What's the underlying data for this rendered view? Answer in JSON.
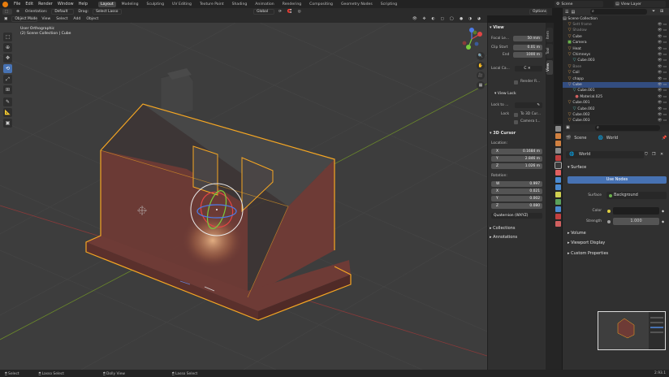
{
  "menubar": {
    "items": [
      "File",
      "Edit",
      "Render",
      "Window",
      "Help"
    ],
    "workspaces": [
      "Layout",
      "Modeling",
      "Sculpting",
      "UV Editing",
      "Texture Paint",
      "Shading",
      "Animation",
      "Rendering",
      "Compositing",
      "Geometry Nodes",
      "Scripting"
    ],
    "active_workspace": "Layout",
    "scene": "Scene",
    "view_layer": "View Layer"
  },
  "header": {
    "orientation_label": "Orientation:",
    "orientation_value": "Default",
    "drag_label": "Drag:",
    "drag_value": "Select Lasso",
    "transform_space": "Global",
    "options_label": "Options"
  },
  "viewport_header": {
    "mode": "Object Mode",
    "menus": [
      "View",
      "Select",
      "Add",
      "Object"
    ]
  },
  "viewport": {
    "view_name": "User Orthographic",
    "collection_info": "(2) Scene Collection | Cube"
  },
  "npanel": {
    "tabs": [
      "Item",
      "Tool",
      "View"
    ],
    "active_tab": "View",
    "view": {
      "title": "View",
      "focal_length_label": "Focal Le...",
      "focal_length": "50 mm",
      "clip_start_label": "Clip Start",
      "clip_start": "0.01 m",
      "clip_end_label": "End",
      "clip_end": "1000 m",
      "local_camera_label": "Local Ca...",
      "local_camera_c": "C",
      "render_region_label": "Render R..."
    },
    "view_lock": {
      "title": "View Lock",
      "lock_to_label": "Lock to ...",
      "lock_label": "Lock",
      "to_3d_cursor": "To 3D Cur...",
      "camera_to": "Camera t..."
    },
    "cursor": {
      "title": "3D Cursor",
      "location_label": "Location:",
      "x_label": "X",
      "x": "0.1684 m",
      "y_label": "Y",
      "y": "2.846 m",
      "z_label": "Z",
      "z": "1.026 m",
      "rotation_label": "Rotation:",
      "w_label": "W",
      "w": "0.997",
      "rx_label": "X",
      "rx": "0.021",
      "ry_label": "Y",
      "ry": "0.002",
      "rz_label": "Z",
      "rz": "0.080",
      "rotation_mode": "Quaternion (WXYZ)"
    },
    "collections_title": "Collections",
    "annotations_title": "Annotations"
  },
  "outliner": {
    "root": "Scene Collection",
    "rows": [
      {
        "indent": 2,
        "icon": "▽",
        "icolor": "#e0a050",
        "label": "Sett frame",
        "dim": true
      },
      {
        "indent": 2,
        "icon": "▽",
        "icolor": "#e0a050",
        "label": "Shadow",
        "dim": true
      },
      {
        "indent": 2,
        "icon": "▽",
        "icolor": "#e0a050",
        "label": "Cube"
      },
      {
        "indent": 2,
        "icon": "■",
        "icolor": "#6ab04c",
        "label": "Camera"
      },
      {
        "indent": 2,
        "icon": "▽",
        "icolor": "#e0a050",
        "label": "Heat"
      },
      {
        "indent": 2,
        "icon": "▽",
        "icolor": "#e0a050",
        "label": "Chimneys"
      },
      {
        "indent": 4,
        "icon": "▽",
        "icolor": "#5ec7c0",
        "label": "Cube.003"
      },
      {
        "indent": 2,
        "icon": "▽",
        "icolor": "#e0a050",
        "label": "Base",
        "dim": true
      },
      {
        "indent": 2,
        "icon": "▽",
        "icolor": "#e0a050",
        "label": "Coil"
      },
      {
        "indent": 2,
        "icon": "▽",
        "icolor": "#e0a050",
        "label": "chapp"
      },
      {
        "indent": 2,
        "icon": "▽",
        "icolor": "#e0a050",
        "label": "Cube",
        "sel": true
      },
      {
        "indent": 4,
        "icon": "▽",
        "icolor": "#5ec7c0",
        "label": "Cube.001"
      },
      {
        "indent": 5,
        "icon": "●",
        "icolor": "#d06060",
        "label": "Material.025"
      },
      {
        "indent": 2,
        "icon": "▽",
        "icolor": "#e0a050",
        "label": "Cube.001"
      },
      {
        "indent": 4,
        "icon": "▽",
        "icolor": "#5ec7c0",
        "label": "Cube.002"
      },
      {
        "indent": 2,
        "icon": "▽",
        "icolor": "#e0a050",
        "label": "Cube.002"
      },
      {
        "indent": 2,
        "icon": "▽",
        "icolor": "#e0a050",
        "label": "Cube.003"
      }
    ]
  },
  "properties": {
    "breadcrumb_scene": "Scene",
    "breadcrumb_world": "World",
    "world_name": "World",
    "surface_title": "Surface",
    "use_nodes": "Use Nodes",
    "surface_label": "Surface",
    "surface_value": "Background",
    "color_label": "Color",
    "strength_label": "Strength",
    "strength_value": "1.000",
    "volume_title": "Volume",
    "viewport_display_title": "Viewport Display",
    "custom_properties_title": "Custom Properties"
  },
  "statusbar": {
    "items": [
      "Select",
      "Lasso Select",
      "Dolly View",
      "Lasso Select"
    ],
    "version": "2.93.1"
  },
  "colors": {
    "accent": "#4772b3",
    "selection_outline": "#f5a623",
    "house_wall": "#6e3b36",
    "grid_x_axis": "#8a3a3a",
    "grid_y_axis": "#6b8a2a"
  }
}
